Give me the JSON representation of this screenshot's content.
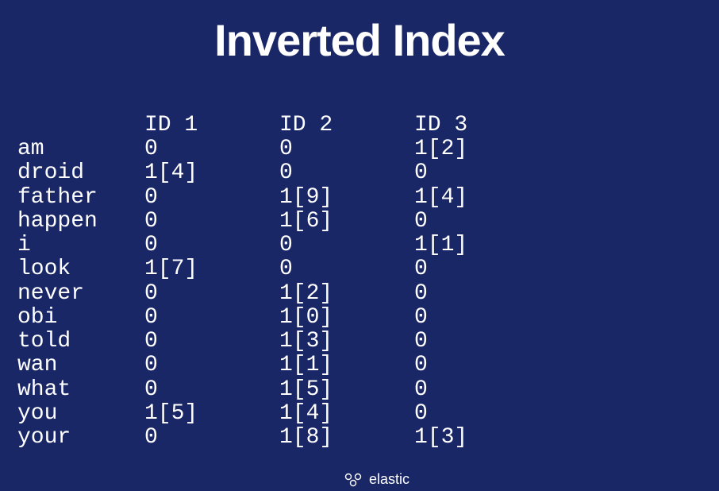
{
  "title": "Inverted Index",
  "headers": [
    "ID 1",
    "ID 2",
    "ID 3"
  ],
  "rows": [
    {
      "term": "am",
      "id1": "0",
      "id2": "0",
      "id3": "1[2]"
    },
    {
      "term": "droid",
      "id1": "1[4]",
      "id2": "0",
      "id3": "0"
    },
    {
      "term": "father",
      "id1": "0",
      "id2": "1[9]",
      "id3": "1[4]"
    },
    {
      "term": "happen",
      "id1": "0",
      "id2": "1[6]",
      "id3": "0"
    },
    {
      "term": "i",
      "id1": "0",
      "id2": "0",
      "id3": "1[1]"
    },
    {
      "term": "look",
      "id1": "1[7]",
      "id2": "0",
      "id3": "0"
    },
    {
      "term": "never",
      "id1": "0",
      "id2": "1[2]",
      "id3": "0"
    },
    {
      "term": "obi",
      "id1": "0",
      "id2": "1[0]",
      "id3": "0"
    },
    {
      "term": "told",
      "id1": "0",
      "id2": "1[3]",
      "id3": "0"
    },
    {
      "term": "wan",
      "id1": "0",
      "id2": "1[1]",
      "id3": "0"
    },
    {
      "term": "what",
      "id1": "0",
      "id2": "1[5]",
      "id3": "0"
    },
    {
      "term": "you",
      "id1": "1[5]",
      "id2": "1[4]",
      "id3": "0"
    },
    {
      "term": "your",
      "id1": "0",
      "id2": "1[8]",
      "id3": "1[3]"
    }
  ],
  "logo_text": "elastic"
}
